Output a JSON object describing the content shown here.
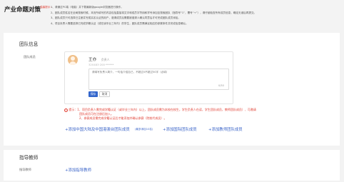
{
  "page_title": "产业命题对策",
  "tips": {
    "label": "温馨提示：",
    "lines": [
      "1、请通过PC端（电脑）并下载最新版google浏览器进行操作。",
      "2、团队成员姓名在全局搜索时候，本页所填写的内容包括直接将文字和成员字符用和学号添加至搜索团队（指导号“1”，署号“+”），请仔细检查所有成员信息，确定无误后再提交。",
      "3、团队成员只可选择已注册并完成实名认证的用户，邀请成员后需要被邀请人确认同意后才可完成团队成员添加。",
      "4、项目负责人需要选择已完成学籍认证（或在读毕业三年内）的学生，团队成员需满足相应的参赛条件并完成信息确认。"
    ]
  },
  "team_section": {
    "title": "团队信息",
    "members_label": "团队成员",
    "member": {
      "name": "王亦",
      "role": "负责人",
      "id_text": "320483·200·******",
      "textarea_placeholder": "请填写负责人简介，一句话介绍自己，不超过0不超过50字（必填）",
      "counter": "0/50",
      "save_label": "保存",
      "cancel_label": "取消"
    },
    "warning": {
      "icon": "!",
      "prefix": "提示：",
      "line1": "1、项目负责人需完成学籍认证（或毕业三年内）以上，团队成员需为本校在校生，学生负责人在读，学生团队成员，教师团队成员）、可邀请",
      "line1b": "团队成员可在注册后加入。",
      "line2": "2、参赛成员需完成学籍认证后才能添加并确认参赛（院校代成员）。"
    },
    "add_links": {
      "china_uni": "+添加中国大陆及中国港澳台团队成员",
      "china_uni_note": "(最多添加10名)",
      "international": "+添加国际团队成员",
      "teacher": "+添加教师团队成员"
    }
  },
  "mentor_section": {
    "title": "指导教师",
    "label": "指导教师",
    "add_link": "+添加指导教师"
  },
  "colors": {
    "accent": "#3366cc",
    "link": "#3a64c8",
    "warning": "#e03b2f",
    "background": "#f3f3f3"
  },
  "icons": {
    "warning": "warning-circle-icon",
    "avatar": "user-avatar-icon"
  }
}
